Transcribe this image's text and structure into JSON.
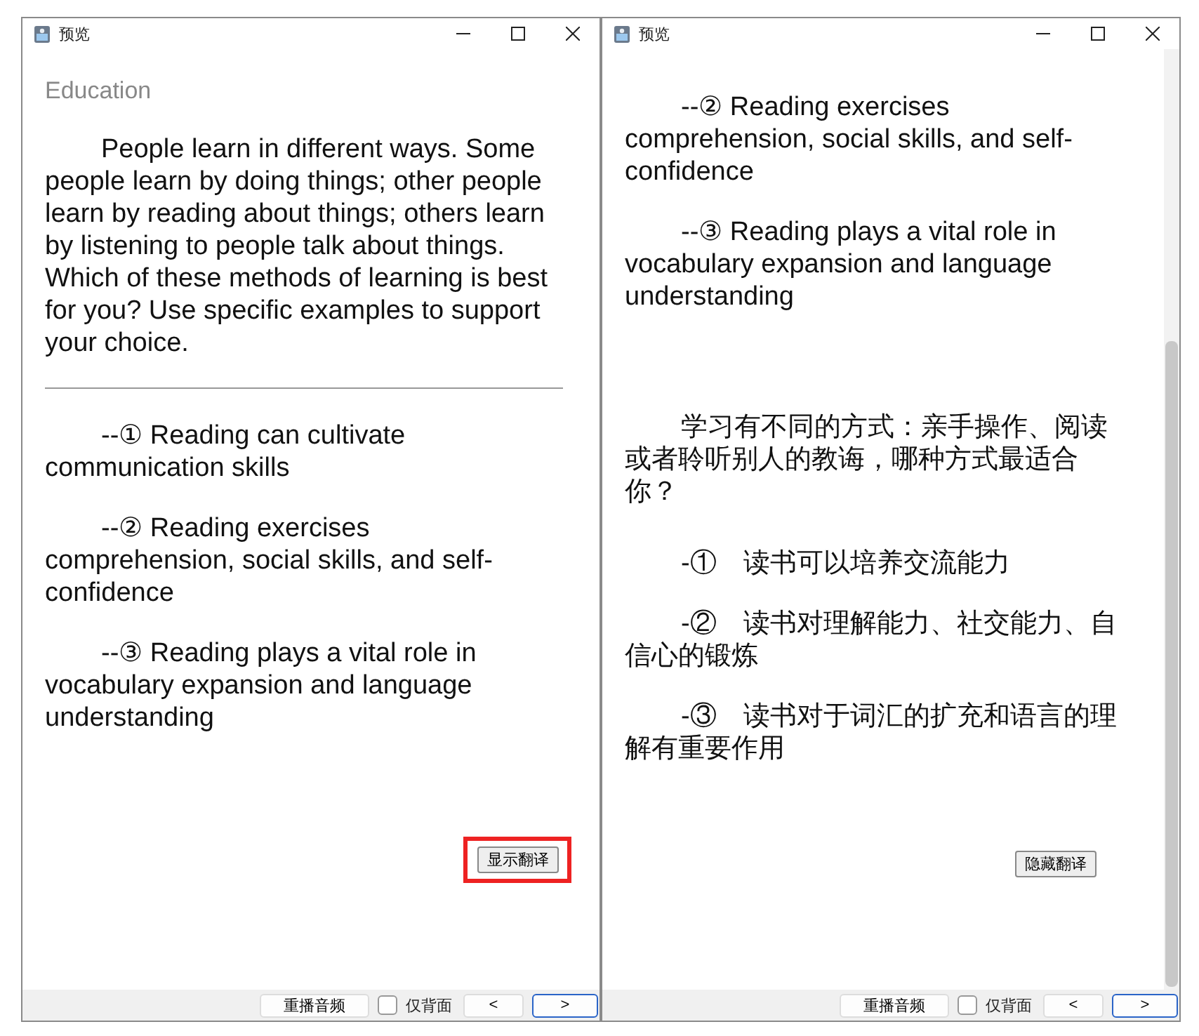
{
  "windows": [
    {
      "title": "预览",
      "has_scrollbar": false,
      "content": [
        {
          "kind": "heading",
          "text": "Education"
        },
        {
          "kind": "paragraph",
          "text": "People learn in different ways. Some people learn by doing things; other people learn by reading about things; others learn by listening to people talk about things. Which of these methods of learning is best for you? Use specific examples to support your choice."
        },
        {
          "kind": "rule"
        },
        {
          "kind": "item",
          "text": "--①  Reading can cultivate communication skills"
        },
        {
          "kind": "item",
          "text": "--②  Reading exercises comprehension, social skills, and self-confidence"
        },
        {
          "kind": "item",
          "text": "--③  Reading plays a vital role in vocabulary expansion and language understanding"
        }
      ],
      "translate_button": {
        "label": "显示翻译",
        "highlighted": true
      },
      "footer": {
        "replay": "重播音频",
        "back_only": {
          "label": "仅背面",
          "checked": false
        },
        "prev": "<",
        "next": ">"
      }
    },
    {
      "title": "预览",
      "has_scrollbar": true,
      "content": [
        {
          "kind": "item",
          "text": "--②  Reading exercises comprehension, social skills, and self-confidence"
        },
        {
          "kind": "item",
          "text": "--③  Reading plays a vital role in vocabulary expansion and language understanding"
        },
        {
          "kind": "spacer"
        },
        {
          "kind": "paragraph",
          "text": "学习有不同的方式：亲手操作、阅读或者聆听别人的教诲，哪种方式最适合你？"
        },
        {
          "kind": "item",
          "text": "-①　读书可以培养交流能力"
        },
        {
          "kind": "item",
          "text": "-②　读书对理解能力、社交能力、自信心的锻炼"
        },
        {
          "kind": "item",
          "text": "-③　读书对于词汇的扩充和语言的理解有重要作用"
        }
      ],
      "translate_button": {
        "label": "隐藏翻译",
        "highlighted": false
      },
      "footer": {
        "replay": "重播音频",
        "back_only": {
          "label": "仅背面",
          "checked": false
        },
        "prev": "<",
        "next": ">"
      }
    }
  ]
}
